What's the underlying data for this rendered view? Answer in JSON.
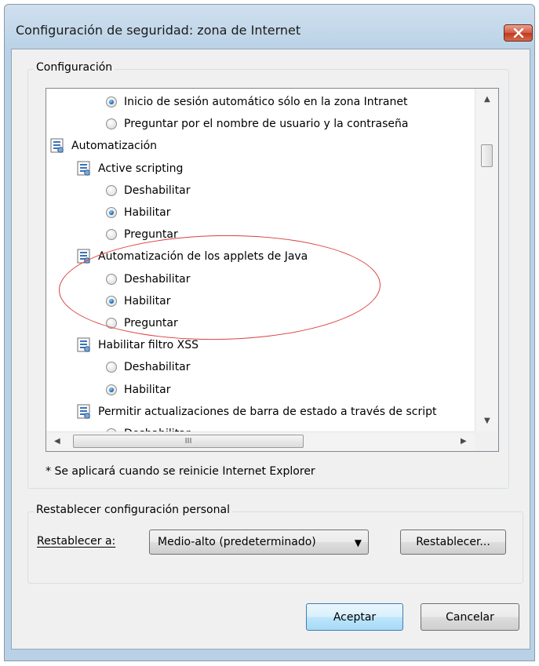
{
  "window": {
    "title": "Configuración de seguridad: zona de Internet",
    "close_icon": "close-icon"
  },
  "settings_group": {
    "label": "Configuración",
    "items": [
      {
        "type": "radio",
        "label": "Inicio de sesión automático sólo en la zona Intranet",
        "checked": true
      },
      {
        "type": "radio",
        "label": "Preguntar por el nombre de usuario y la contraseña",
        "checked": false
      },
      {
        "type": "category",
        "label": "Automatización",
        "icon": "settings-doc-icon"
      },
      {
        "type": "setting",
        "label": "Active scripting",
        "icon": "settings-doc-icon"
      },
      {
        "type": "radio",
        "label": "Deshabilitar",
        "checked": false
      },
      {
        "type": "radio",
        "label": "Habilitar",
        "checked": true
      },
      {
        "type": "radio",
        "label": "Preguntar",
        "checked": false
      },
      {
        "type": "setting",
        "label": "Automatización de los applets de Java",
        "icon": "settings-doc-icon"
      },
      {
        "type": "radio",
        "label": "Deshabilitar",
        "checked": false
      },
      {
        "type": "radio",
        "label": "Habilitar",
        "checked": true
      },
      {
        "type": "radio",
        "label": "Preguntar",
        "checked": false
      },
      {
        "type": "setting",
        "label": "Habilitar filtro XSS",
        "icon": "settings-doc-icon"
      },
      {
        "type": "radio",
        "label": "Deshabilitar",
        "checked": false
      },
      {
        "type": "radio",
        "label": "Habilitar",
        "checked": true
      },
      {
        "type": "setting",
        "label": "Permitir actualizaciones de barra de estado a través de script",
        "icon": "settings-doc-icon"
      },
      {
        "type": "radio",
        "label": "Deshabilitar",
        "checked": true
      }
    ],
    "note": "* Se aplicará cuando se reinicie Internet Explorer"
  },
  "reset_group": {
    "label": "Restablecer configuración personal",
    "reset_to_label": "Restablecer a:",
    "selected_level": "Medio-alto (predeterminado)",
    "reset_button": "Restablecer..."
  },
  "buttons": {
    "ok": "Aceptar",
    "cancel": "Cancelar"
  },
  "colors": {
    "highlight_ellipse": "#d9413f",
    "title_bar": "#b9d1e6",
    "close_button": "#c0391f"
  }
}
